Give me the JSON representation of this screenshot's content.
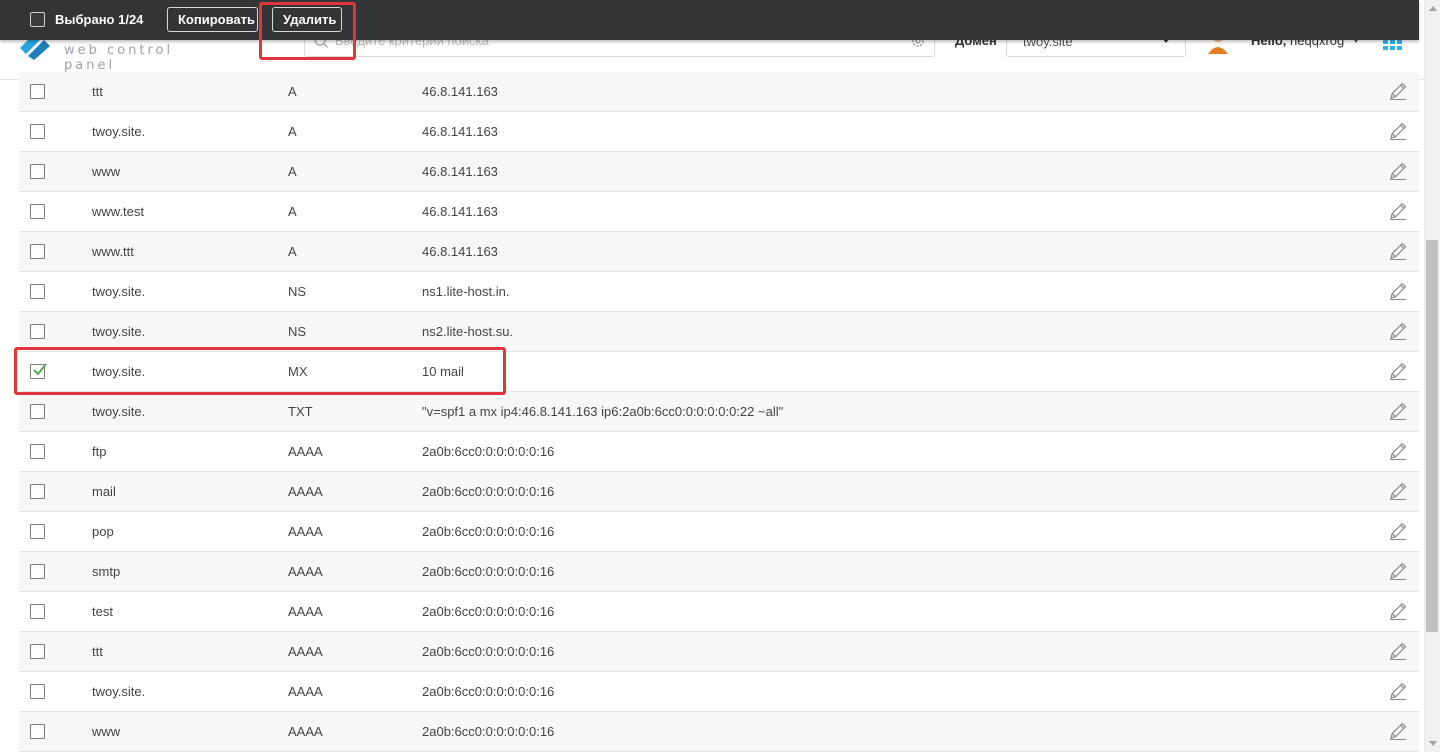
{
  "header": {
    "logo_text": "web control panel",
    "search_placeholder": "Введите критерии поиска",
    "domain_label": "Домен",
    "domain_value": "twoy.site",
    "greeting": "Hello,",
    "username": "heqqxrog"
  },
  "actionbar": {
    "selected_text": "Выбрано 1/24",
    "copy_label": "Копировать",
    "delete_label": "Удалить"
  },
  "icons": {
    "edit": "pencil-icon",
    "search": "search-icon",
    "settings": "gear-icon",
    "apps": "apps-grid-icon"
  },
  "colors": {
    "actionbar_bg": "#333436",
    "highlight": "#e0353d",
    "check": "#4caf50",
    "apps_icon": "#29b6f6"
  },
  "records": [
    {
      "name": "ttt",
      "type": "A",
      "value": "46.8.141.163",
      "checked": false
    },
    {
      "name": "twoy.site.",
      "type": "A",
      "value": "46.8.141.163",
      "checked": false
    },
    {
      "name": "www",
      "type": "A",
      "value": "46.8.141.163",
      "checked": false
    },
    {
      "name": "www.test",
      "type": "A",
      "value": "46.8.141.163",
      "checked": false
    },
    {
      "name": "www.ttt",
      "type": "A",
      "value": "46.8.141.163",
      "checked": false
    },
    {
      "name": "twoy.site.",
      "type": "NS",
      "value": "ns1.lite-host.in.",
      "checked": false
    },
    {
      "name": "twoy.site.",
      "type": "NS",
      "value": "ns2.lite-host.su.",
      "checked": false
    },
    {
      "name": "twoy.site.",
      "type": "MX",
      "value": "10 mail",
      "checked": true
    },
    {
      "name": "twoy.site.",
      "type": "TXT",
      "value": "\"v=spf1 a mx ip4:46.8.141.163 ip6:2a0b:6cc0:0:0:0:0:0:22 ~all\"",
      "checked": false
    },
    {
      "name": "ftp",
      "type": "AAAA",
      "value": "2a0b:6cc0:0:0:0:0:0:16",
      "checked": false
    },
    {
      "name": "mail",
      "type": "AAAA",
      "value": "2a0b:6cc0:0:0:0:0:0:16",
      "checked": false
    },
    {
      "name": "pop",
      "type": "AAAA",
      "value": "2a0b:6cc0:0:0:0:0:0:16",
      "checked": false
    },
    {
      "name": "smtp",
      "type": "AAAA",
      "value": "2a0b:6cc0:0:0:0:0:0:16",
      "checked": false
    },
    {
      "name": "test",
      "type": "AAAA",
      "value": "2a0b:6cc0:0:0:0:0:0:16",
      "checked": false
    },
    {
      "name": "ttt",
      "type": "AAAA",
      "value": "2a0b:6cc0:0:0:0:0:0:16",
      "checked": false
    },
    {
      "name": "twoy.site.",
      "type": "AAAA",
      "value": "2a0b:6cc0:0:0:0:0:0:16",
      "checked": false
    },
    {
      "name": "www",
      "type": "AAAA",
      "value": "2a0b:6cc0:0:0:0:0:0:16",
      "checked": false
    }
  ]
}
